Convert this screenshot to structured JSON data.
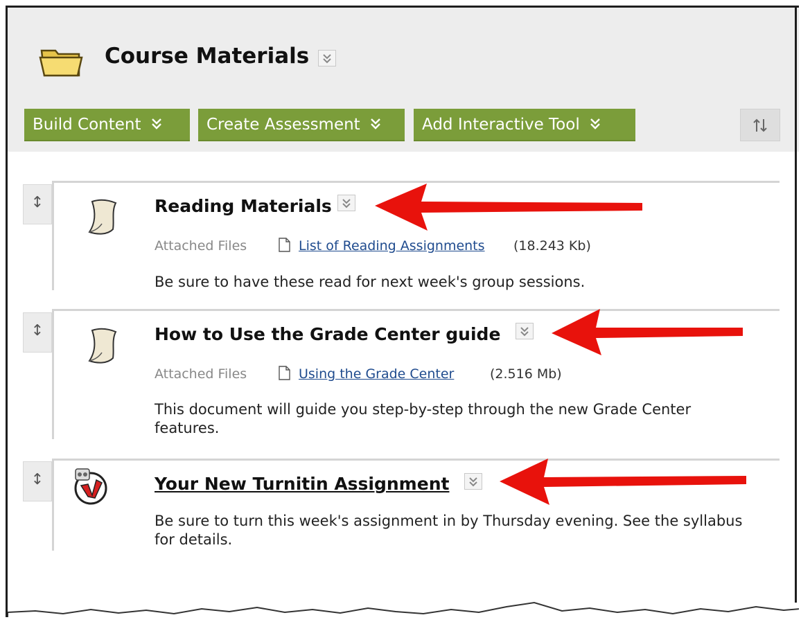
{
  "page": {
    "title": "Course Materials"
  },
  "toolbar": {
    "build_content": "Build Content",
    "create_assessment": "Create Assessment",
    "add_interactive_tool": "Add Interactive Tool",
    "reorder_icon": "reorder-arrows-icon"
  },
  "items": [
    {
      "title": "Reading Materials",
      "attached_label": "Attached Files",
      "file_name": "List of Reading Assignments",
      "file_size": "(18.243 Kb)",
      "description": "Be sure to have these read for next week's group sessions.",
      "icon": "document-icon"
    },
    {
      "title": "How to Use the Grade Center guide",
      "attached_label": "Attached Files",
      "file_name": "Using the Grade Center",
      "file_size": "(2.516 Mb)",
      "description": "This document will guide you step-by-step through the new Grade Center features.",
      "icon": "document-icon"
    },
    {
      "title": "Your New Turnitin Assignment",
      "description": "Be sure to turn this week's assignment in by Thursday evening. See the syllabus for details.",
      "icon": "turnitin-icon"
    }
  ],
  "colors": {
    "toolbar_green": "#7b9d3a",
    "header_bg": "#ededed",
    "link_blue": "#1f4b8e",
    "arrow_red": "#e8120c"
  }
}
